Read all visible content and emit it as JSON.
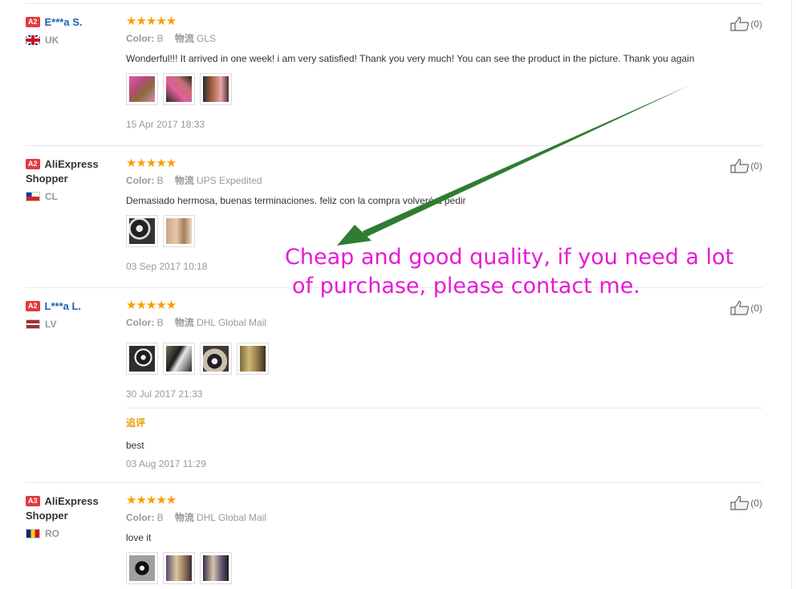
{
  "reviews": [
    {
      "level": "A2",
      "name": "E***a S.",
      "country": "UK",
      "stars": "★★★★★",
      "color_label": "Color:",
      "color_value": "B",
      "shipping_label": "物流",
      "shipping_value": "GLS",
      "text": "Wonderful!!! It arrived in one week! i am very satisfied! Thank you very much! You can see the product in the picture. Thank you again",
      "date": "15 Apr 2017 18:33",
      "likes": "(0)"
    },
    {
      "level": "A2",
      "name_line1": "AliExpress",
      "name_line2": "Shopper",
      "country": "CL",
      "stars": "★★★★★",
      "color_label": "Color:",
      "color_value": "B",
      "shipping_label": "物流",
      "shipping_value": "UPS Expedited",
      "text": "Demasiado hermosa, buenas terminaciones. feliz con la compra volveré a pedir",
      "date": "03 Sep 2017 10:18",
      "likes": "(0)"
    },
    {
      "level": "A2",
      "name": "L***a L.",
      "country": "LV",
      "stars": "★★★★★",
      "color_label": "Color:",
      "color_value": "B",
      "shipping_label": "物流",
      "shipping_value": "DHL Global Mail",
      "date": "30 Jul 2017 21:33",
      "likes": "(0)",
      "additional_title": "追评",
      "additional_text": "best",
      "additional_date": "03 Aug 2017 11:29"
    },
    {
      "level": "A3",
      "name_line1": "AliExpress",
      "name_line2": "Shopper",
      "country": "RO",
      "stars": "★★★★★",
      "color_label": "Color:",
      "color_value": "B",
      "shipping_label": "物流",
      "shipping_value": "DHL Global Mail",
      "text": "love it",
      "likes": "(0)"
    }
  ],
  "overlay": {
    "line1": "Cheap and good quality, if you need a lot",
    "line2": "of purchase, please contact me."
  },
  "colors": {
    "star": "#ff9c00",
    "badge": "#e4393c",
    "masked_name": "#1d63b6",
    "overlay_text": "#e61ad6",
    "arrow": "#2e7d32",
    "additional_title": "#e5a100"
  },
  "icons": {
    "like": "thumbs-up-icon",
    "flags": [
      "uk-flag-icon",
      "chile-flag-icon",
      "latvia-flag-icon",
      "romania-flag-icon"
    ]
  }
}
